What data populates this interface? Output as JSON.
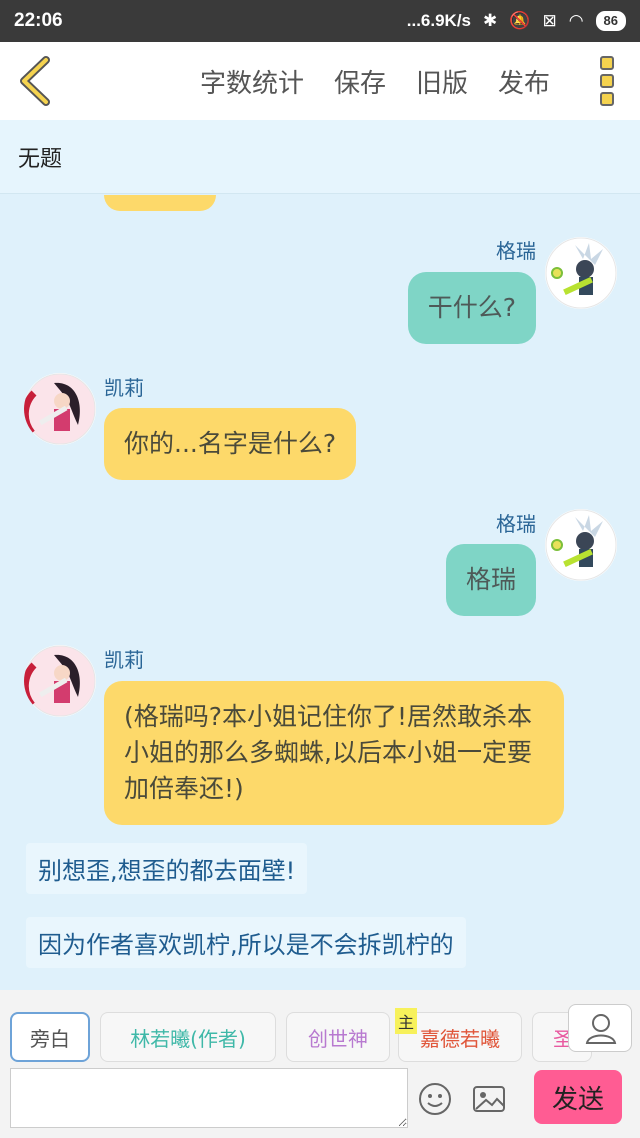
{
  "status": {
    "time": "22:06",
    "speed": "...6.9K/s",
    "battery": "86"
  },
  "topbar": {
    "actions": [
      "字数统计",
      "保存",
      "旧版",
      "发布"
    ]
  },
  "title": "无题",
  "messages": [
    {
      "side": "right",
      "name": "格瑞",
      "text": "干什么?"
    },
    {
      "side": "left",
      "name": "凯莉",
      "text": "你的...名字是什么?"
    },
    {
      "side": "right",
      "name": "格瑞",
      "text": "格瑞"
    },
    {
      "side": "left",
      "name": "凯莉",
      "text": "(格瑞吗?本小姐记住你了!居然敢杀本小姐的那么多蜘蛛,以后本小姐一定要加倍奉还!)"
    }
  ],
  "narrations": [
    "别想歪,想歪的都去面壁!",
    "因为作者喜欢凯柠,所以是不会拆凯柠的"
  ],
  "roles": [
    {
      "label": "旁白",
      "color": "#555555"
    },
    {
      "label": "林若曦(作者)",
      "color": "#3fb8a8"
    },
    {
      "label": "创世神",
      "color": "#b87ad0"
    },
    {
      "label": "嘉德若曦",
      "color": "#e0563a"
    },
    {
      "label": "圣",
      "color": "#e85aa0"
    }
  ],
  "main_tag": "主",
  "input": {
    "placeholder": ""
  },
  "send_label": "发送",
  "colors": {
    "right_bubble": "#7fd5c6",
    "left_bubble": "#fdd96a",
    "send": "#ff5c93",
    "background": "#dff1fb"
  }
}
